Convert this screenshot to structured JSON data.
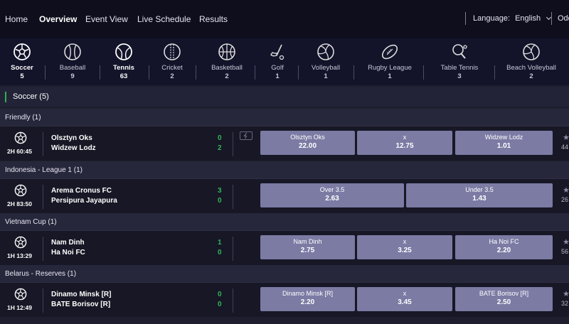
{
  "nav": {
    "links": [
      "Home",
      "Overview",
      "Event View",
      "Live Schedule",
      "Results"
    ],
    "language_label": "Language:",
    "language_value": "English",
    "odds_cut": "Odd"
  },
  "sports": [
    {
      "name": "Soccer",
      "count": "5",
      "icon": "soccer-ball-icon"
    },
    {
      "name": "Baseball",
      "count": "9",
      "icon": "baseball-icon"
    },
    {
      "name": "Tennis",
      "count": "63",
      "icon": "tennis-ball-icon"
    },
    {
      "name": "Cricket",
      "count": "2",
      "icon": "cricket-ball-icon"
    },
    {
      "name": "Basketball",
      "count": "2",
      "icon": "basketball-icon"
    },
    {
      "name": "Golf",
      "count": "1",
      "icon": "golf-club-icon"
    },
    {
      "name": "Volleyball",
      "count": "1",
      "icon": "volleyball-icon"
    },
    {
      "name": "Rugby League",
      "count": "1",
      "icon": "rugby-ball-icon"
    },
    {
      "name": "Table Tennis",
      "count": "3",
      "icon": "table-tennis-icon"
    },
    {
      "name": "Beach Volleyball",
      "count": "2",
      "icon": "beach-volleyball-icon"
    }
  ],
  "section": {
    "title": "Soccer (5)"
  },
  "leagues": [
    {
      "name": "Friendly (1)",
      "match": {
        "time": "2H 60:45",
        "home": "Olsztyn Oks",
        "away": "Widzew Lodz",
        "home_score": "0",
        "away_score": "2",
        "more": "44",
        "odds": [
          {
            "label": "Olsztyn Oks",
            "value": "22.00"
          },
          {
            "label": "x",
            "value": "12.75"
          },
          {
            "label": "Widzew Lodz",
            "value": "1.01"
          }
        ]
      }
    },
    {
      "name": "Indonesia - League 1 (1)",
      "match": {
        "time": "2H 83:50",
        "home": "Arema Cronus FC",
        "away": "Persipura Jayapura",
        "home_score": "3",
        "away_score": "0",
        "more": "26",
        "odds": [
          {
            "label": "Over 3.5",
            "value": "2.63"
          },
          {
            "label": "Under 3.5",
            "value": "1.43"
          }
        ]
      }
    },
    {
      "name": "Vietnam Cup (1)",
      "match": {
        "time": "1H 13:29",
        "home": "Nam Dinh",
        "away": "Ha Noi FC",
        "home_score": "1",
        "away_score": "0",
        "more": "56",
        "odds": [
          {
            "label": "Nam Dinh",
            "value": "2.75"
          },
          {
            "label": "x",
            "value": "3.25"
          },
          {
            "label": "Ha Noi FC",
            "value": "2.20"
          }
        ]
      }
    },
    {
      "name": "Belarus - Reserves (1)",
      "match": {
        "time": "1H 12:49",
        "home": "Dinamo Minsk [R]",
        "away": "BATE Borisov [R]",
        "home_score": "0",
        "away_score": "0",
        "more": "32",
        "odds": [
          {
            "label": "Dinamo Minsk [R]",
            "value": "2.20"
          },
          {
            "label": "x",
            "value": "3.45"
          },
          {
            "label": "BATE Borisov [R]",
            "value": "2.50"
          }
        ]
      }
    }
  ],
  "colors": {
    "accent_green": "#2fb050",
    "odds_button": "#7b7ba4"
  }
}
